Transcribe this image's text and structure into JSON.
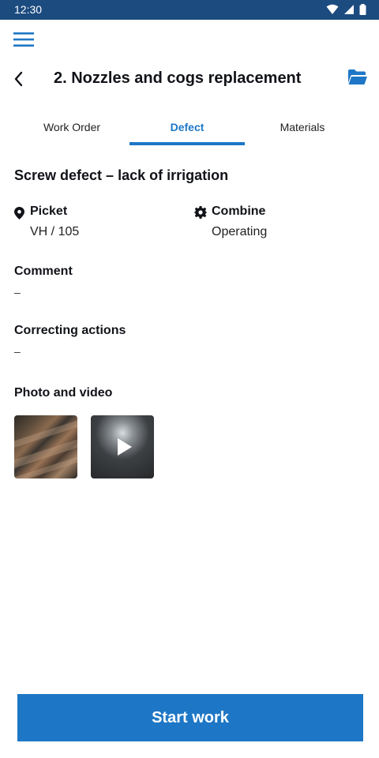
{
  "status_bar": {
    "time": "12:30"
  },
  "header": {
    "title": "2. Nozzles and cogs replacement"
  },
  "tabs": [
    {
      "label": "Work Order",
      "active": false
    },
    {
      "label": "Defect",
      "active": true
    },
    {
      "label": "Materials",
      "active": false
    }
  ],
  "defect": {
    "title": "Screw defect – lack of irrigation",
    "picket_label": "Picket",
    "picket_value": "VH / 105",
    "combine_label": "Combine",
    "combine_value": "Operating",
    "comment_label": "Comment",
    "comment_value": "–",
    "actions_label": "Correcting actions",
    "actions_value": "–",
    "media_label": "Photo and video"
  },
  "footer": {
    "start_label": "Start work"
  },
  "colors": {
    "accent": "#1e77c6",
    "status_bar": "#1c4b7f"
  }
}
